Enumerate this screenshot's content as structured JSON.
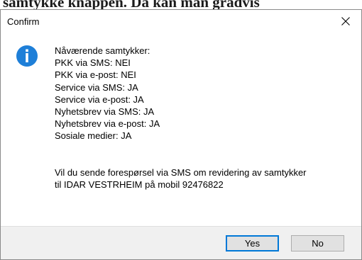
{
  "background": {
    "partial_text": "samtykke knappen. Da kan man gradvis"
  },
  "dialog": {
    "title": "Confirm",
    "close_glyph": "✕",
    "icon": "info-icon",
    "lines": [
      "Nåværende samtykker:",
      "PKK via SMS: NEI",
      "PKK via e-post: NEI",
      "Service via SMS: JA",
      "Service via e-post: JA",
      "Nyhetsbrev via SMS: JA",
      "Nyhetsbrev via e-post: JA",
      "Sosiale medier: JA"
    ],
    "question": [
      "Vil du sende forespørsel via SMS om revidering av samtykker",
      "til IDAR VESTRHEIM på mobil 92476822"
    ],
    "buttons": {
      "yes": "Yes",
      "no": "No"
    }
  },
  "colors": {
    "info_icon": "#1e7fd8",
    "default_button_border": "#0078d7",
    "footer_bg": "#f0f0f0"
  }
}
